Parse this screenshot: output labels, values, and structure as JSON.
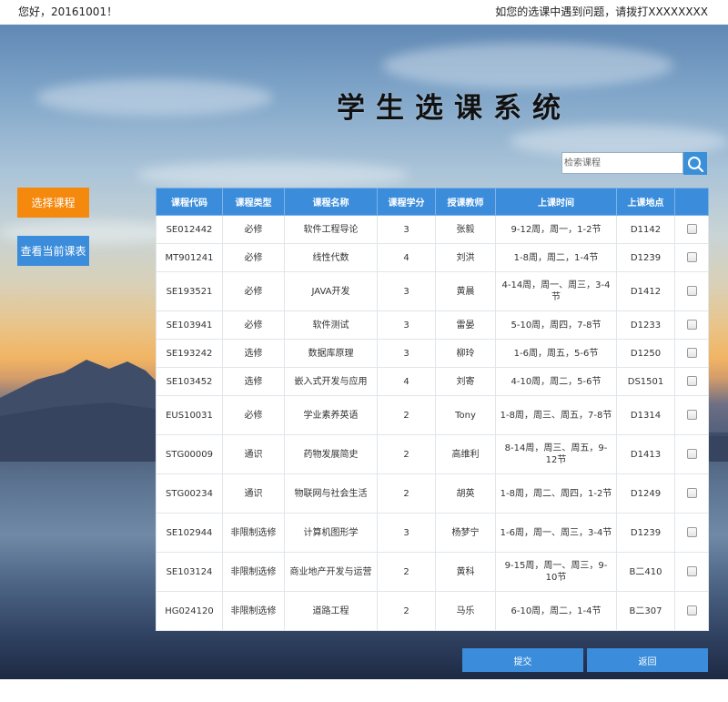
{
  "topbar": {
    "greeting": "您好，20161001！",
    "help": "如您的选课中遇到问题，请拨打XXXXXXXX"
  },
  "title": "学生选课系统",
  "search": {
    "placeholder": "检索课程",
    "value": "",
    "icon": "search-icon"
  },
  "sidebar": {
    "choose_label": "选择课程",
    "view_label": "查看当前课表"
  },
  "table": {
    "headers": [
      "课程代码",
      "课程类型",
      "课程名称",
      "课程学分",
      "授课教师",
      "上课时间",
      "上课地点",
      ""
    ],
    "rows": [
      {
        "code": "SE012442",
        "type": "必修",
        "name": "软件工程导论",
        "credit": "3",
        "teacher": "张毅",
        "time": "9-12周，周一，1-2节",
        "place": "D1142"
      },
      {
        "code": "MT901241",
        "type": "必修",
        "name": "线性代数",
        "credit": "4",
        "teacher": "刘洪",
        "time": "1-8周，周二，1-4节",
        "place": "D1239"
      },
      {
        "code": "SE193521",
        "type": "必修",
        "name": "JAVA开发",
        "credit": "3",
        "teacher": "黄晨",
        "time": "4-14周，周一、周三，3-4节",
        "place": "D1412"
      },
      {
        "code": "SE103941",
        "type": "必修",
        "name": "软件测试",
        "credit": "3",
        "teacher": "雷晏",
        "time": "5-10周，周四，7-8节",
        "place": "D1233"
      },
      {
        "code": "SE193242",
        "type": "选修",
        "name": "数据库原理",
        "credit": "3",
        "teacher": "柳玲",
        "time": "1-6周，周五，5-6节",
        "place": "D1250"
      },
      {
        "code": "SE103452",
        "type": "选修",
        "name": "嵌入式开发与应用",
        "credit": "4",
        "teacher": "刘寄",
        "time": "4-10周，周二，5-6节",
        "place": "DS1501"
      },
      {
        "code": "EUS10031",
        "type": "必修",
        "name": "学业素养英语",
        "credit": "2",
        "teacher": "Tony",
        "time": "1-8周，周三、周五，7-8节",
        "place": "D1314"
      },
      {
        "code": "STG00009",
        "type": "通识",
        "name": "药物发展简史",
        "credit": "2",
        "teacher": "高维利",
        "time": "8-14周，周三、周五，9-12节",
        "place": "D1413"
      },
      {
        "code": "STG00234",
        "type": "通识",
        "name": "物联网与社会生活",
        "credit": "2",
        "teacher": "胡英",
        "time": "1-8周，周二、周四，1-2节",
        "place": "D1249"
      },
      {
        "code": "SE102944",
        "type": "非限制选修",
        "name": "计算机图形学",
        "credit": "3",
        "teacher": "杨梦宁",
        "time": "1-6周，周一、周三，3-4节",
        "place": "D1239"
      },
      {
        "code": "SE103124",
        "type": "非限制选修",
        "name": "商业地产开发与运营",
        "credit": "2",
        "teacher": "黄科",
        "time": "9-15周，周一、周三，9-10节",
        "place": "B二410"
      },
      {
        "code": "HG024120",
        "type": "非限制选修",
        "name": "道路工程",
        "credit": "2",
        "teacher": "马乐",
        "time": "6-10周，周二，1-4节",
        "place": "B二307"
      }
    ]
  },
  "actions": {
    "submit_label": "提交",
    "back_label": "返回"
  },
  "colors": {
    "accent_blue": "#3b8ddb",
    "accent_orange": "#f5890e"
  }
}
